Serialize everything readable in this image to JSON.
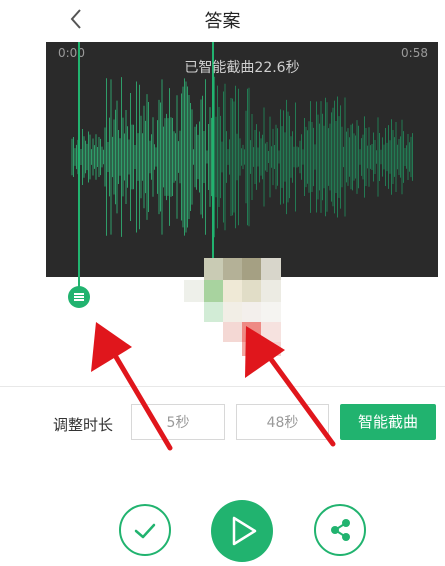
{
  "header": {
    "title": "答案"
  },
  "waveform": {
    "start_time": "0:00",
    "end_time": "0:58",
    "smart_info": "已智能截曲22.6秒"
  },
  "duration": {
    "label": "调整时长",
    "start_value": "5秒",
    "end_value": "48秒",
    "smart_cut_label": "智能截曲"
  },
  "colors": {
    "accent": "#21b36f",
    "arrow": "#e0161c",
    "panel_bg": "#2a2a2a"
  },
  "icons": {
    "back": "chevron-left-icon",
    "confirm": "check-icon",
    "play": "play-icon",
    "share": "share-icon",
    "handle": "menu-icon"
  }
}
